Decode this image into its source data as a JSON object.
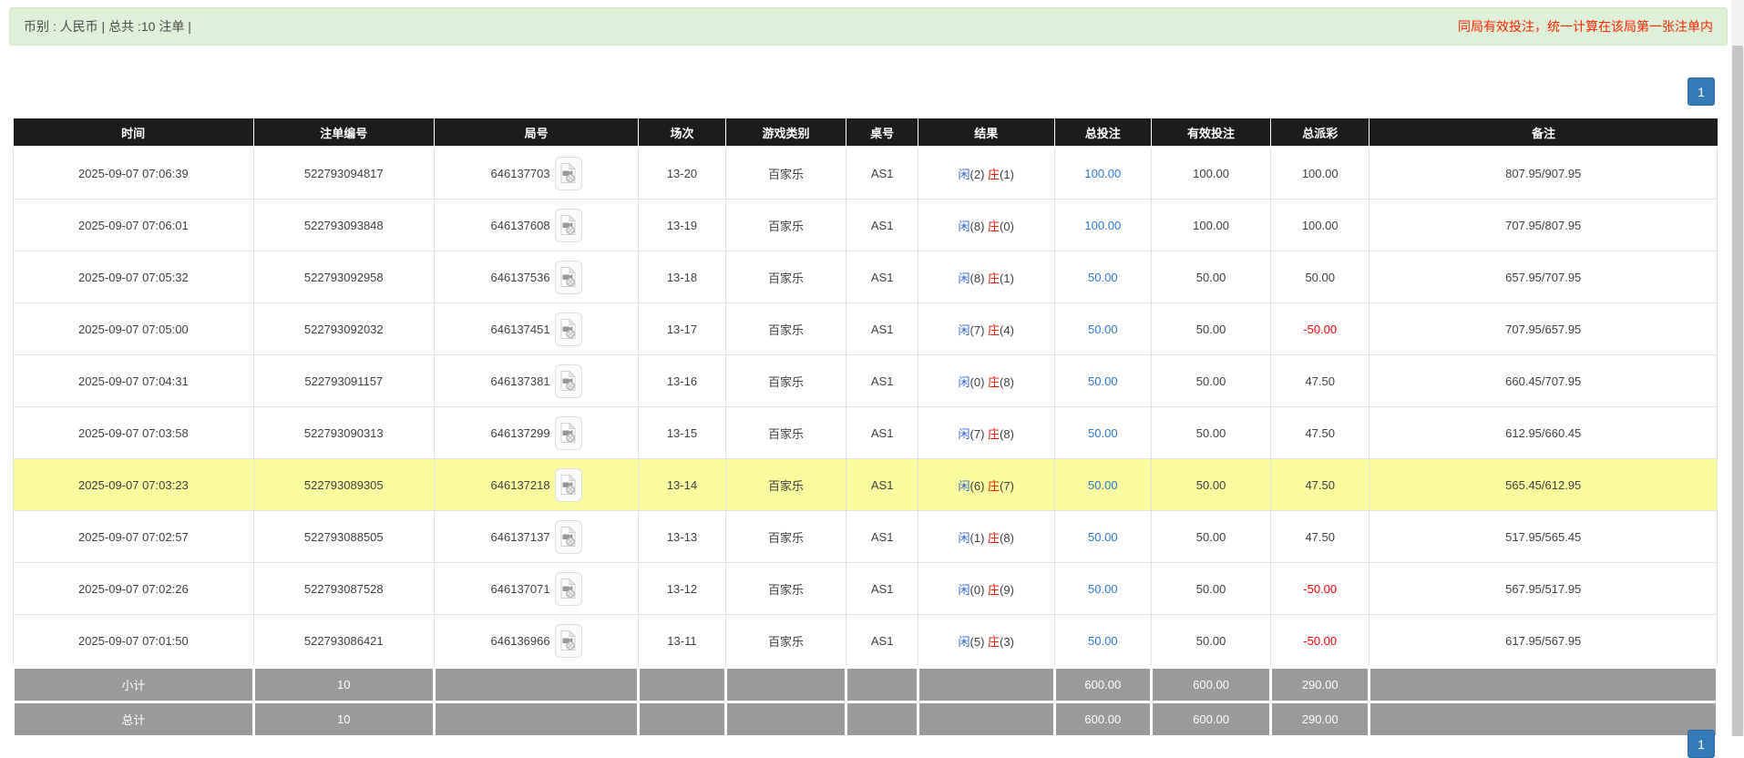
{
  "summary_bar": {
    "left_text": "币别 : 人民币 | 总共 :10 注单 |",
    "right_note": "同局有效投注，统一计算在该局第一张注单内"
  },
  "pagination": {
    "current_page": "1"
  },
  "icons": {
    "round_video": "video-file-icon"
  },
  "colors": {
    "alert_bg": "#dff0d8",
    "note_red": "#ff2400",
    "header_bg": "#1c1c1c",
    "footer_bg": "#9a9a9a",
    "highlight_row": "#fafa9e",
    "link_blue": "#2b7ad6",
    "player_blue": "#3366cc",
    "banker_red": "#ee1100",
    "negative_red": "#ff0000",
    "pager_blue": "#337ab7"
  },
  "table": {
    "headers": [
      "时间",
      "注单编号",
      "局号",
      "场次",
      "游戏类别",
      "桌号",
      "结果",
      "总投注",
      "有效投注",
      "总派彩",
      "备注"
    ],
    "rows": [
      {
        "time": "2025-09-07 07:06:39",
        "bet_no": "522793094817",
        "round_no": "646137703",
        "session": "13-20",
        "game_type": "百家乐",
        "table_no": "AS1",
        "result": [
          "闲",
          "(2)",
          "庄",
          "(1)"
        ],
        "total_bet": "100.00",
        "valid_bet": "100.00",
        "payout": "100.00",
        "remark": "807.95/907.95",
        "highlight": false
      },
      {
        "time": "2025-09-07 07:06:01",
        "bet_no": "522793093848",
        "round_no": "646137608",
        "session": "13-19",
        "game_type": "百家乐",
        "table_no": "AS1",
        "result": [
          "闲",
          "(8)",
          "庄",
          "(0)"
        ],
        "total_bet": "100.00",
        "valid_bet": "100.00",
        "payout": "100.00",
        "remark": "707.95/807.95",
        "highlight": false
      },
      {
        "time": "2025-09-07 07:05:32",
        "bet_no": "522793092958",
        "round_no": "646137536",
        "session": "13-18",
        "game_type": "百家乐",
        "table_no": "AS1",
        "result": [
          "闲",
          "(8)",
          "庄",
          "(1)"
        ],
        "total_bet": "50.00",
        "valid_bet": "50.00",
        "payout": "50.00",
        "remark": "657.95/707.95",
        "highlight": false
      },
      {
        "time": "2025-09-07 07:05:00",
        "bet_no": "522793092032",
        "round_no": "646137451",
        "session": "13-17",
        "game_type": "百家乐",
        "table_no": "AS1",
        "result": [
          "闲",
          "(7)",
          "庄",
          "(4)"
        ],
        "total_bet": "50.00",
        "valid_bet": "50.00",
        "payout": "-50.00",
        "remark": "707.95/657.95",
        "highlight": false
      },
      {
        "time": "2025-09-07 07:04:31",
        "bet_no": "522793091157",
        "round_no": "646137381",
        "session": "13-16",
        "game_type": "百家乐",
        "table_no": "AS1",
        "result": [
          "闲",
          "(0)",
          "庄",
          "(8)"
        ],
        "total_bet": "50.00",
        "valid_bet": "50.00",
        "payout": "47.50",
        "remark": "660.45/707.95",
        "highlight": false
      },
      {
        "time": "2025-09-07 07:03:58",
        "bet_no": "522793090313",
        "round_no": "646137299",
        "session": "13-15",
        "game_type": "百家乐",
        "table_no": "AS1",
        "result": [
          "闲",
          "(7)",
          "庄",
          "(8)"
        ],
        "total_bet": "50.00",
        "valid_bet": "50.00",
        "payout": "47.50",
        "remark": "612.95/660.45",
        "highlight": false
      },
      {
        "time": "2025-09-07 07:03:23",
        "bet_no": "522793089305",
        "round_no": "646137218",
        "session": "13-14",
        "game_type": "百家乐",
        "table_no": "AS1",
        "result": [
          "闲",
          "(6)",
          "庄",
          "(7)"
        ],
        "total_bet": "50.00",
        "valid_bet": "50.00",
        "payout": "47.50",
        "remark": "565.45/612.95",
        "highlight": true
      },
      {
        "time": "2025-09-07 07:02:57",
        "bet_no": "522793088505",
        "round_no": "646137137",
        "session": "13-13",
        "game_type": "百家乐",
        "table_no": "AS1",
        "result": [
          "闲",
          "(1)",
          "庄",
          "(8)"
        ],
        "total_bet": "50.00",
        "valid_bet": "50.00",
        "payout": "47.50",
        "remark": "517.95/565.45",
        "highlight": false
      },
      {
        "time": "2025-09-07 07:02:26",
        "bet_no": "522793087528",
        "round_no": "646137071",
        "session": "13-12",
        "game_type": "百家乐",
        "table_no": "AS1",
        "result": [
          "闲",
          "(0)",
          "庄",
          "(9)"
        ],
        "total_bet": "50.00",
        "valid_bet": "50.00",
        "payout": "-50.00",
        "remark": "567.95/517.95",
        "highlight": false
      },
      {
        "time": "2025-09-07 07:01:50",
        "bet_no": "522793086421",
        "round_no": "646136966",
        "session": "13-11",
        "game_type": "百家乐",
        "table_no": "AS1",
        "result": [
          "闲",
          "(5)",
          "庄",
          "(3)"
        ],
        "total_bet": "50.00",
        "valid_bet": "50.00",
        "payout": "-50.00",
        "remark": "617.95/567.95",
        "highlight": false
      }
    ],
    "subtotal": {
      "label": "小计",
      "count": "10",
      "total_bet": "600.00",
      "valid_bet": "600.00",
      "payout": "290.00"
    },
    "total": {
      "label": "总计",
      "count": "10",
      "total_bet": "600.00",
      "valid_bet": "600.00",
      "payout": "290.00"
    }
  }
}
